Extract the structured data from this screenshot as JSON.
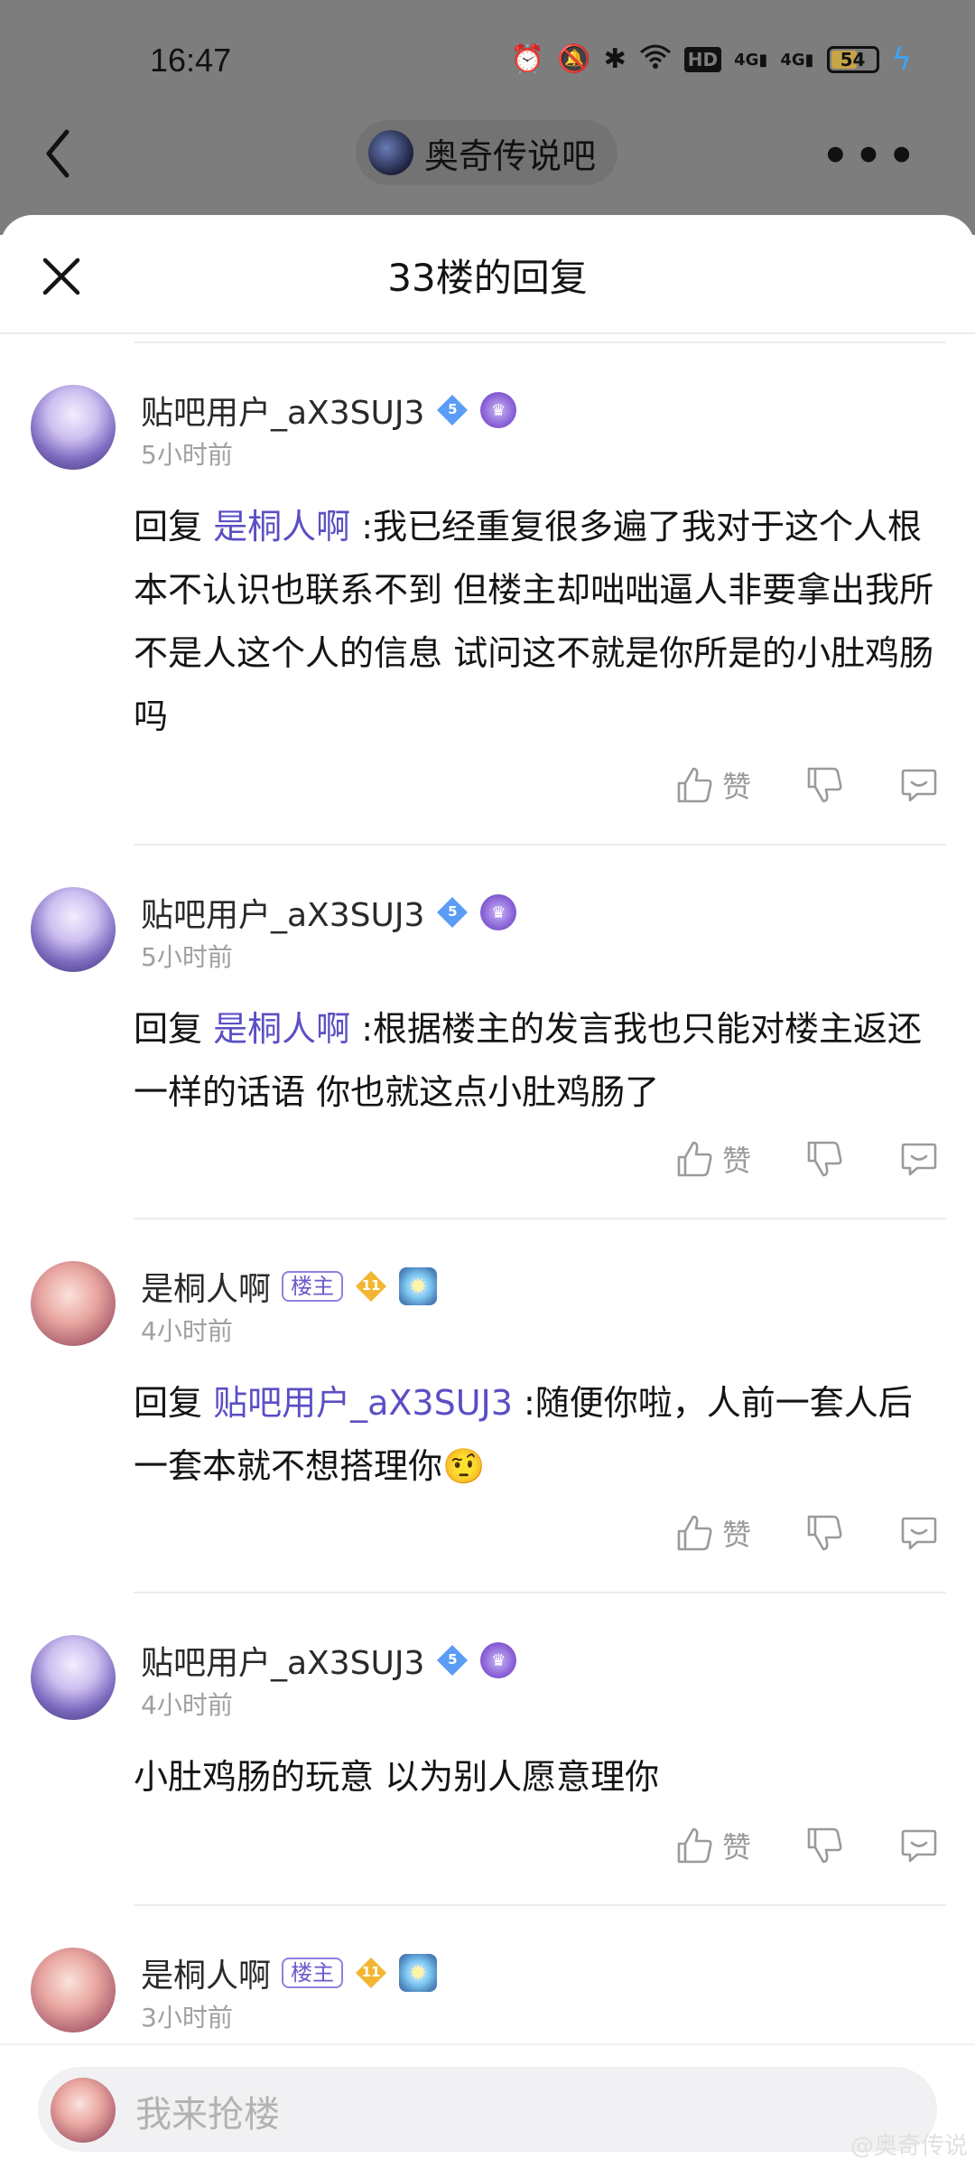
{
  "status_bar": {
    "time": "16:47",
    "battery": "54",
    "battery_level": 0.54,
    "icons": [
      "alarm-icon",
      "mute-icon",
      "bluetooth-icon",
      "wifi-icon",
      "hd-icon",
      "signal-4g-icon",
      "signal-4g-icon",
      "battery-icon",
      "charging-icon"
    ],
    "hd_label": "HD",
    "net1": "4G",
    "net2": "4G"
  },
  "nav": {
    "forum_name": "奥奇传说吧",
    "more": "•••"
  },
  "sheet": {
    "title": "33楼的回复"
  },
  "replies": [
    {
      "username": "贴吧用户_aX3SUJ3",
      "level": "5",
      "time": "5小时前",
      "prefix": "回复 ",
      "mention": "是桐人啊",
      "text": " :我已经重复很多遍了我对于这个人根本不认识也联系不到 但楼主却咄咄逼人非要拿出我所不是人这个人的信息 试问这不就是你所是的小肚鸡肠吗",
      "like_label": "赞"
    },
    {
      "username": "贴吧用户_aX3SUJ3",
      "level": "5",
      "time": "5小时前",
      "prefix": "回复 ",
      "mention": "是桐人啊",
      "text": " :根据楼主的发言我也只能对楼主返还一样的话语 你也就这点小肚鸡肠了",
      "like_label": "赞"
    },
    {
      "username": "是桐人啊",
      "owner_tag": "楼主",
      "level": "11",
      "time": "4小时前",
      "prefix": "回复 ",
      "mention": "贴吧用户_aX3SUJ3",
      "text": " :随便你啦，人前一套人后一套本就不想搭理你",
      "emoji": "🤨",
      "like_label": "赞"
    },
    {
      "username": "贴吧用户_aX3SUJ3",
      "level": "5",
      "time": "4小时前",
      "text": "小肚鸡肠的玩意 以为别人愿意理你",
      "like_label": "赞"
    },
    {
      "username": "是桐人啊",
      "owner_tag": "楼主",
      "level": "11",
      "time": "3小时前"
    }
  ],
  "input": {
    "placeholder": "我来抢楼"
  },
  "watermark": "@奥奇传说",
  "colors": {
    "mention": "#5b4fc4",
    "diamond_blue": "#5b9cf5",
    "diamond_gold": "#f2b632",
    "owner_tag": "#6a5acd"
  }
}
